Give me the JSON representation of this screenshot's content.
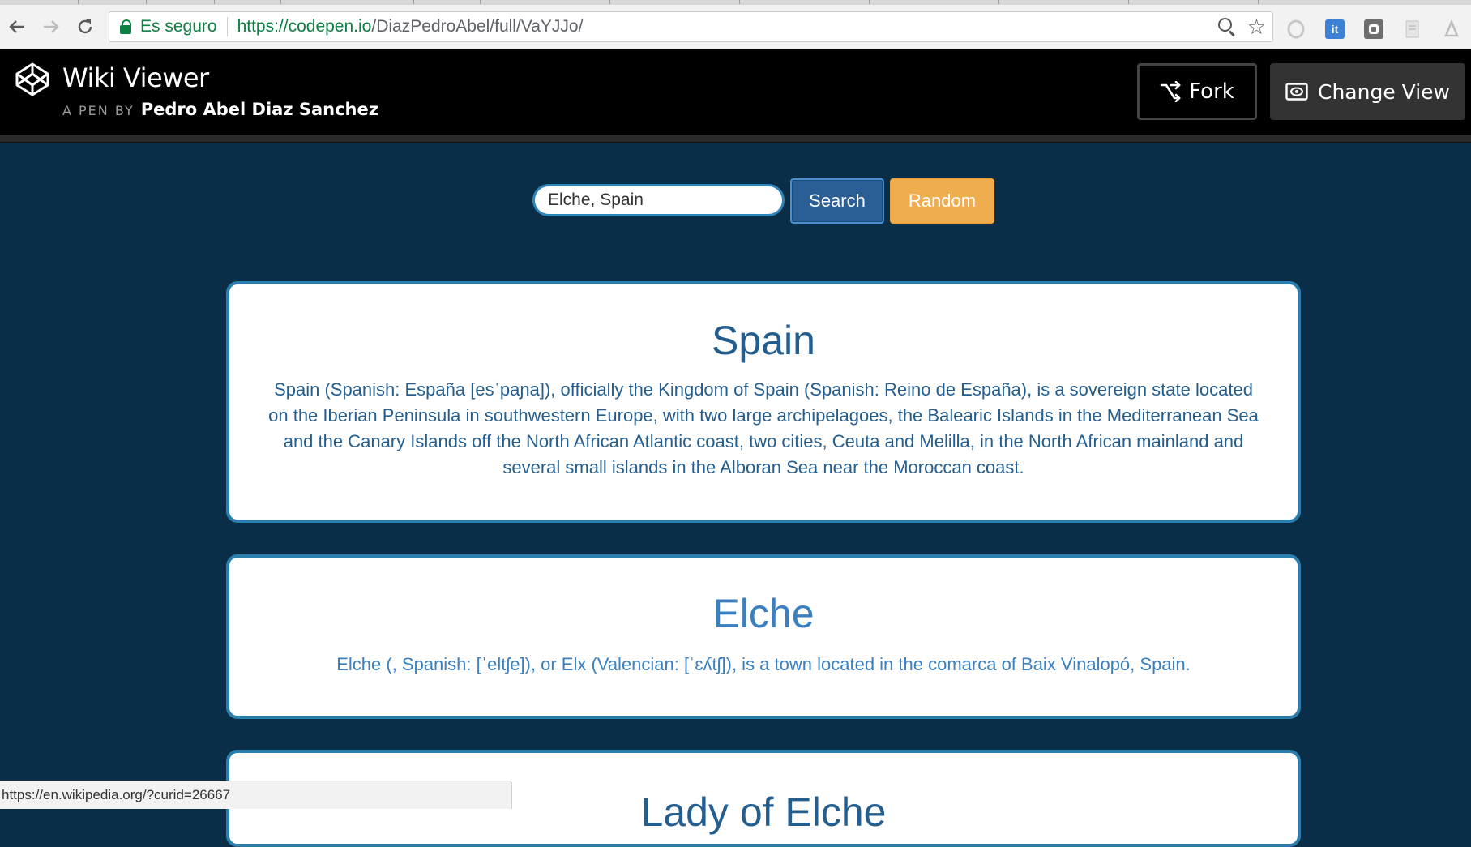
{
  "browser": {
    "security_label": "Es seguro",
    "url_host": "https://codepen.io",
    "url_path": "/DiazPedroAbel/full/VaYJJo/",
    "back_icon": "arrow-left-icon",
    "forward_icon": "arrow-right-icon",
    "reload_icon": "reload-icon",
    "extensions": [
      {
        "name": "opera-extension",
        "color": "#c8c8c8",
        "glyph": ""
      },
      {
        "name": "it-extension",
        "color": "#3b82d6",
        "glyph": "it"
      },
      {
        "name": "gray-extension",
        "color": "#6e6e6e",
        "glyph": ""
      },
      {
        "name": "doc-extension",
        "color": "#c8c8c8",
        "glyph": ""
      },
      {
        "name": "pdf-extension",
        "color": "#bdbdbd",
        "glyph": ""
      }
    ],
    "status_url": "https://en.wikipedia.org/?curid=26667"
  },
  "codepen": {
    "title": "Wiki Viewer",
    "byline_label": "A PEN BY",
    "author": "Pedro Abel Diaz Sanchez",
    "fork_label": "Fork",
    "change_view_label": "Change View"
  },
  "search": {
    "value": "Elche, Spain",
    "search_label": "Search",
    "random_label": "Random"
  },
  "results": [
    {
      "title": "Spain",
      "text": "Spain (Spanish: España [esˈpaɲa]), officially the Kingdom of Spain (Spanish: Reino de España), is a sovereign state located on the Iberian Peninsula in southwestern Europe, with two large archipelagoes, the Balearic Islands in the Mediterranean Sea and the Canary Islands off the North African Atlantic coast, two cities, Ceuta and Melilla, in the North African mainland and several small islands in the Alboran Sea near the Moroccan coast."
    },
    {
      "title": "Elche",
      "text": "Elche (, Spanish: [ˈeltʃe]), or Elx (Valencian: [ˈɛʎtʃ]), is a town located in the comarca of Baix Vinalopó, Spain."
    },
    {
      "title": "Lady of Elche",
      "text": ""
    }
  ],
  "colors": {
    "page_background": "#0a2e47",
    "card_border": "#2b7fae",
    "search_button": "#2a5f96",
    "random_button": "#f0ad4e",
    "secure_green": "#0b8043"
  }
}
